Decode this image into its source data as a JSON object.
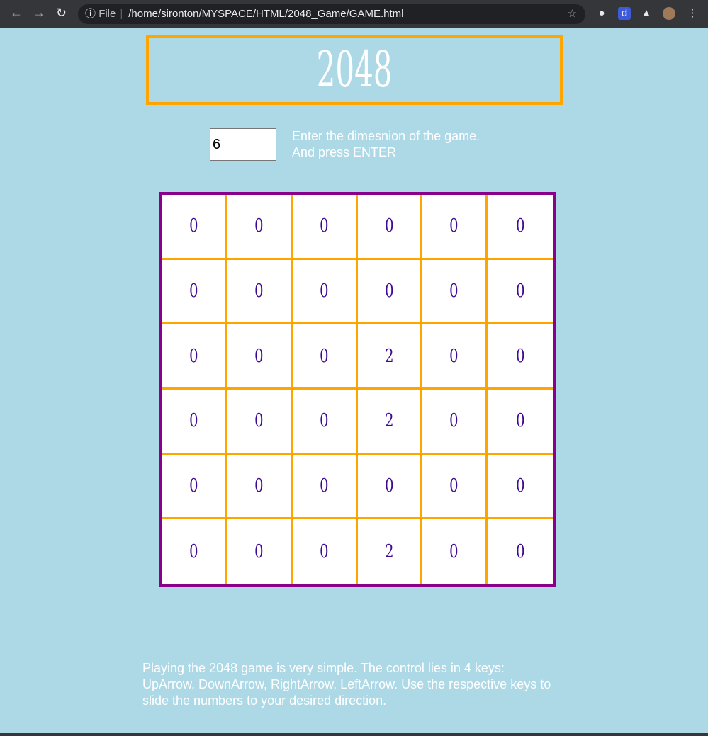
{
  "browser": {
    "file_label": "File",
    "url": "/home/sironton/MYSPACE/HTML/2048_Game/GAME.html"
  },
  "title": "2048",
  "dimension_input": {
    "value": "6"
  },
  "hint": {
    "line1": "Enter the dimesnion of the game.",
    "line2": "And press ENTER"
  },
  "board": [
    [
      "0",
      "0",
      "0",
      "0",
      "0",
      "0"
    ],
    [
      "0",
      "0",
      "0",
      "0",
      "0",
      "0"
    ],
    [
      "0",
      "0",
      "0",
      "2",
      "0",
      "0"
    ],
    [
      "0",
      "0",
      "0",
      "2",
      "0",
      "0"
    ],
    [
      "0",
      "0",
      "0",
      "0",
      "0",
      "0"
    ],
    [
      "0",
      "0",
      "0",
      "2",
      "0",
      "0"
    ]
  ],
  "rules": "Playing the 2048 game is very simple. The control lies in 4 keys: UpArrow, DownArrow, RightArrow, LeftArrow. Use the respective keys to slide the numbers to your desired direction.",
  "colors": {
    "background": "#add8e6",
    "title_border": "#ffa500",
    "board_border": "#8b008b",
    "cell_text": "#3d0a91"
  }
}
